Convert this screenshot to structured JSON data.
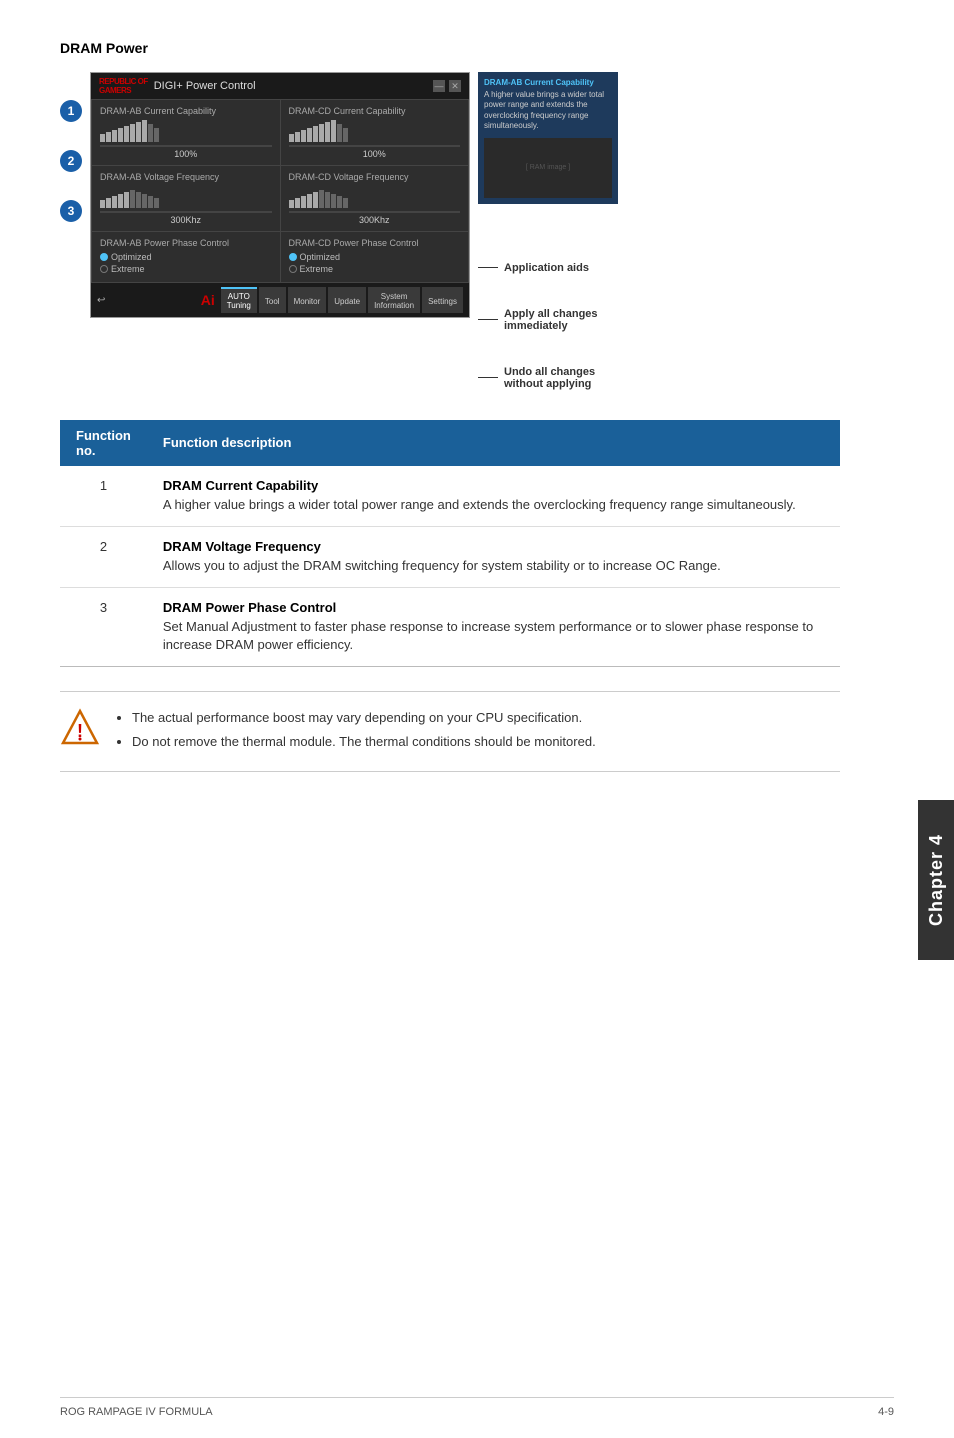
{
  "page": {
    "title": "DRAM Power",
    "section_header": "DRAM Power"
  },
  "window": {
    "title": "DIGI+ Power Control",
    "logo": "REPUBLIC OF GAMERS",
    "panels": [
      {
        "label": "DRAM-AB Current Capability",
        "value": "100%",
        "type": "slider"
      },
      {
        "label": "DRAM-CD Current Capability",
        "value": "100%",
        "type": "slider"
      },
      {
        "label": "DRAM-AB Voltage Frequency",
        "value": "300Khz",
        "type": "slider"
      },
      {
        "label": "DRAM-CD Voltage Frequency",
        "value": "300Khz",
        "type": "slider"
      },
      {
        "label": "DRAM-AB Power Phase Control",
        "options": [
          "Optimized",
          "Extreme"
        ],
        "selected": "Optimized",
        "type": "radio"
      },
      {
        "label": "DRAM-CD Power Phase Control",
        "options": [
          "Optimized",
          "Extreme"
        ],
        "selected": "Optimized",
        "type": "radio"
      }
    ],
    "info_panel": {
      "title": "DRAM-AB Current Capability",
      "description": "A higher value brings a wider total power range and extends the overclocking frequency range simultaneously."
    }
  },
  "annotations": [
    {
      "id": "annotation-application-aids",
      "text": "Application aids"
    },
    {
      "id": "annotation-apply-all",
      "text": "Apply all changes\nimmediately"
    },
    {
      "id": "annotation-undo-all",
      "text": "Undo all changes\nwithout applying"
    }
  ],
  "circle_numbers": [
    "1",
    "2",
    "3"
  ],
  "table": {
    "headers": [
      "Function no.",
      "Function description"
    ],
    "rows": [
      {
        "number": "1",
        "name": "DRAM Current Capability",
        "description": "A higher value brings a wider total power range and extends the overclocking frequency range simultaneously."
      },
      {
        "number": "2",
        "name": "DRAM Voltage Frequency",
        "description": "Allows you to adjust the DRAM switching frequency for system stability or to increase OC Range."
      },
      {
        "number": "3",
        "name": "DRAM Power Phase Control",
        "description": "Set Manual Adjustment to faster phase response to increase system performance or to slower phase response to increase DRAM power efficiency."
      }
    ]
  },
  "warnings": [
    "The actual performance boost may vary depending on your CPU specification.",
    "Do not remove the thermal module. The thermal conditions should be monitored."
  ],
  "chapter": {
    "label": "Chapter 4"
  },
  "footer": {
    "left": "ROG RAMPAGE IV FORMULA",
    "right": "4-9"
  },
  "nav_buttons": [
    "Tool",
    "Monitor",
    "Update",
    "System Information",
    "Settings"
  ],
  "toolbar": {
    "undo_symbol": "↩"
  }
}
